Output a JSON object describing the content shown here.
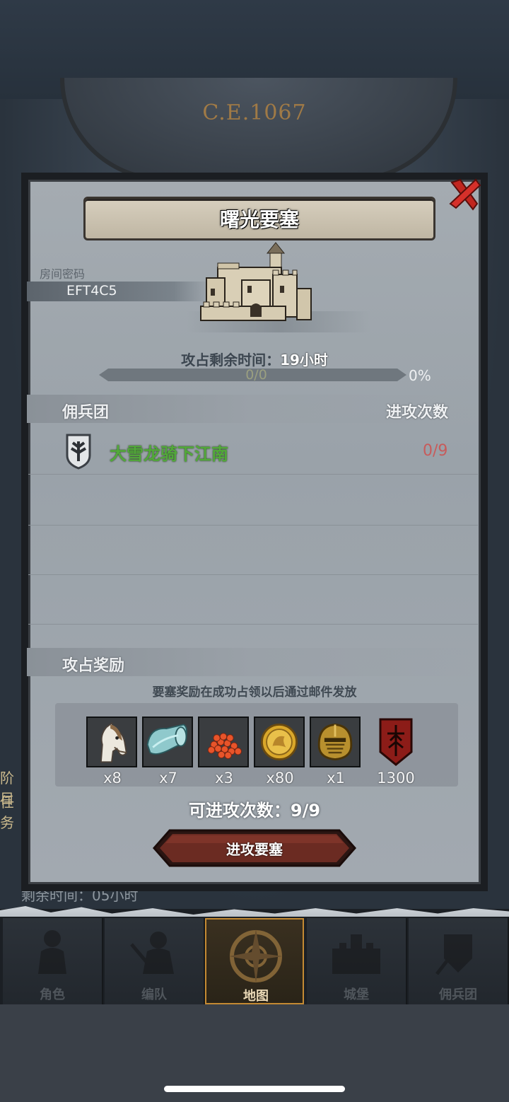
{
  "background": {
    "era": "C.E.1067",
    "left_strip": [
      "阶目",
      "任务"
    ],
    "remaining_time_fragment": "剩余时间：05小时"
  },
  "modal": {
    "title": "曙光要塞",
    "room_label": "房间密码",
    "room_code": "EFT4C5",
    "remaining_label": "攻占剩余时间：",
    "remaining_value": "19小时",
    "progress": {
      "text": "0/0",
      "percent_text": "0%",
      "fraction": 0
    },
    "mercenary_header": "佣兵团",
    "attack_count_header": "进攻次数",
    "guilds": [
      {
        "name": "大雪龙骑下江南",
        "attacks": "0/9"
      }
    ],
    "rewards_header": "攻占奖励",
    "rewards_note": "要塞奖励在成功占领以后通过邮件发放",
    "rewards": [
      {
        "icon": "horse-icon",
        "qty": "x8"
      },
      {
        "icon": "cloth-roll-icon",
        "qty": "x7"
      },
      {
        "icon": "caviar-icon",
        "qty": "x3"
      },
      {
        "icon": "gold-coin-icon",
        "qty": "x80"
      },
      {
        "icon": "knight-helmet-icon",
        "qty": "x1"
      },
      {
        "icon": "red-banner-icon",
        "qty": "1300"
      }
    ],
    "attack_available": "可进攻次数：9/9",
    "attack_button": "进攻要塞"
  },
  "nav": [
    {
      "label": "角色",
      "icon": "character-icon",
      "active": false
    },
    {
      "label": "编队",
      "icon": "formation-icon",
      "active": false
    },
    {
      "label": "地图",
      "icon": "compass-map-icon",
      "active": true
    },
    {
      "label": "城堡",
      "icon": "castle-icon",
      "active": false
    },
    {
      "label": "佣兵团",
      "icon": "mercenary-icon",
      "active": false
    }
  ],
  "colors": {
    "guild_name": "#52a93a",
    "guild_attacks": "#c75b5b",
    "attack_button": "#6b2b22",
    "nav_active_border": "#c48a33"
  }
}
